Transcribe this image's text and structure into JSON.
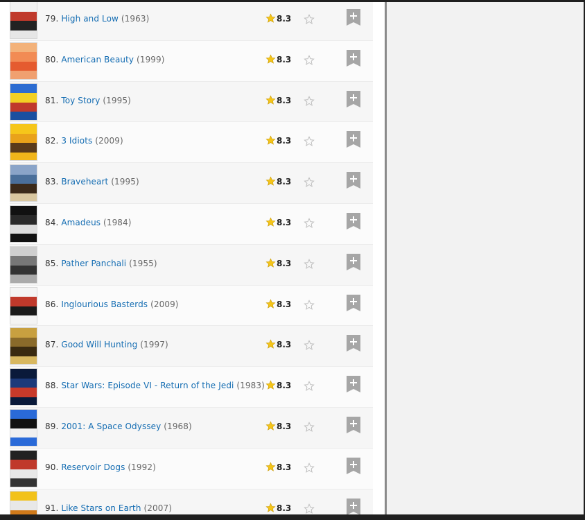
{
  "movies": [
    {
      "rank": "79.",
      "title": "High and Low",
      "year": "(1963)",
      "rating": "8.3",
      "poster_colors": [
        "#f2f2f2",
        "#c0392b",
        "#222222",
        "#e6e6e6"
      ]
    },
    {
      "rank": "80.",
      "title": "American Beauty",
      "year": "(1999)",
      "rating": "8.3",
      "poster_colors": [
        "#f3b27a",
        "#f28b54",
        "#e55b2f",
        "#f0a070"
      ]
    },
    {
      "rank": "81.",
      "title": "Toy Story",
      "year": "(1995)",
      "rating": "8.3",
      "poster_colors": [
        "#2c6cd1",
        "#f2d024",
        "#c0392b",
        "#1a4fa0"
      ]
    },
    {
      "rank": "82.",
      "title": "3 Idiots",
      "year": "(2009)",
      "rating": "8.3",
      "poster_colors": [
        "#f6c61a",
        "#e9a21a",
        "#5a3a1a",
        "#f1b51a"
      ]
    },
    {
      "rank": "83.",
      "title": "Braveheart",
      "year": "(1995)",
      "rating": "8.3",
      "poster_colors": [
        "#8aa4c8",
        "#4a6f9a",
        "#3b2a1a",
        "#d9c7a0"
      ]
    },
    {
      "rank": "84.",
      "title": "Amadeus",
      "year": "(1984)",
      "rating": "8.3",
      "poster_colors": [
        "#111111",
        "#2a2a2a",
        "#dddddd",
        "#111111"
      ]
    },
    {
      "rank": "85.",
      "title": "Pather Panchali",
      "year": "(1955)",
      "rating": "8.3",
      "poster_colors": [
        "#cfcfcf",
        "#777777",
        "#333333",
        "#aaaaaa"
      ]
    },
    {
      "rank": "86.",
      "title": "Inglourious Basterds",
      "year": "(2009)",
      "rating": "8.3",
      "poster_colors": [
        "#f4f4f4",
        "#c0392b",
        "#1a1a1a",
        "#f4f4f4"
      ]
    },
    {
      "rank": "87.",
      "title": "Good Will Hunting",
      "year": "(1997)",
      "rating": "8.3",
      "poster_colors": [
        "#c8a040",
        "#8a6a2a",
        "#3a2a10",
        "#d8b860"
      ]
    },
    {
      "rank": "88.",
      "title": "Star Wars: Episode VI - Return of the Jedi",
      "year": "(1983)",
      "rating": "8.3",
      "poster_colors": [
        "#0a1a3a",
        "#1c3a7a",
        "#c83a2a",
        "#0a1a3a"
      ]
    },
    {
      "rank": "89.",
      "title": "2001: A Space Odyssey",
      "year": "(1968)",
      "rating": "8.3",
      "poster_colors": [
        "#2a6ad8",
        "#111111",
        "#f0f0f0",
        "#2a6ad8"
      ]
    },
    {
      "rank": "90.",
      "title": "Reservoir Dogs",
      "year": "(1992)",
      "rating": "8.3",
      "poster_colors": [
        "#222222",
        "#c0392b",
        "#e8e8e8",
        "#333333"
      ]
    },
    {
      "rank": "91.",
      "title": "Like Stars on Earth",
      "year": "(2007)",
      "rating": "8.3",
      "poster_colors": [
        "#f2c21a",
        "#e8e8e8",
        "#d07a1a",
        "#f2c21a"
      ]
    }
  ],
  "colors": {
    "link": "#136cb2",
    "star_gold": "#f5c518",
    "watchlist_gray": "#a6a6a6"
  },
  "icons": {
    "imdb_rating": "gold-star-icon",
    "rate": "empty-star-icon",
    "watchlist": "watchlist-ribbon-plus-icon"
  }
}
